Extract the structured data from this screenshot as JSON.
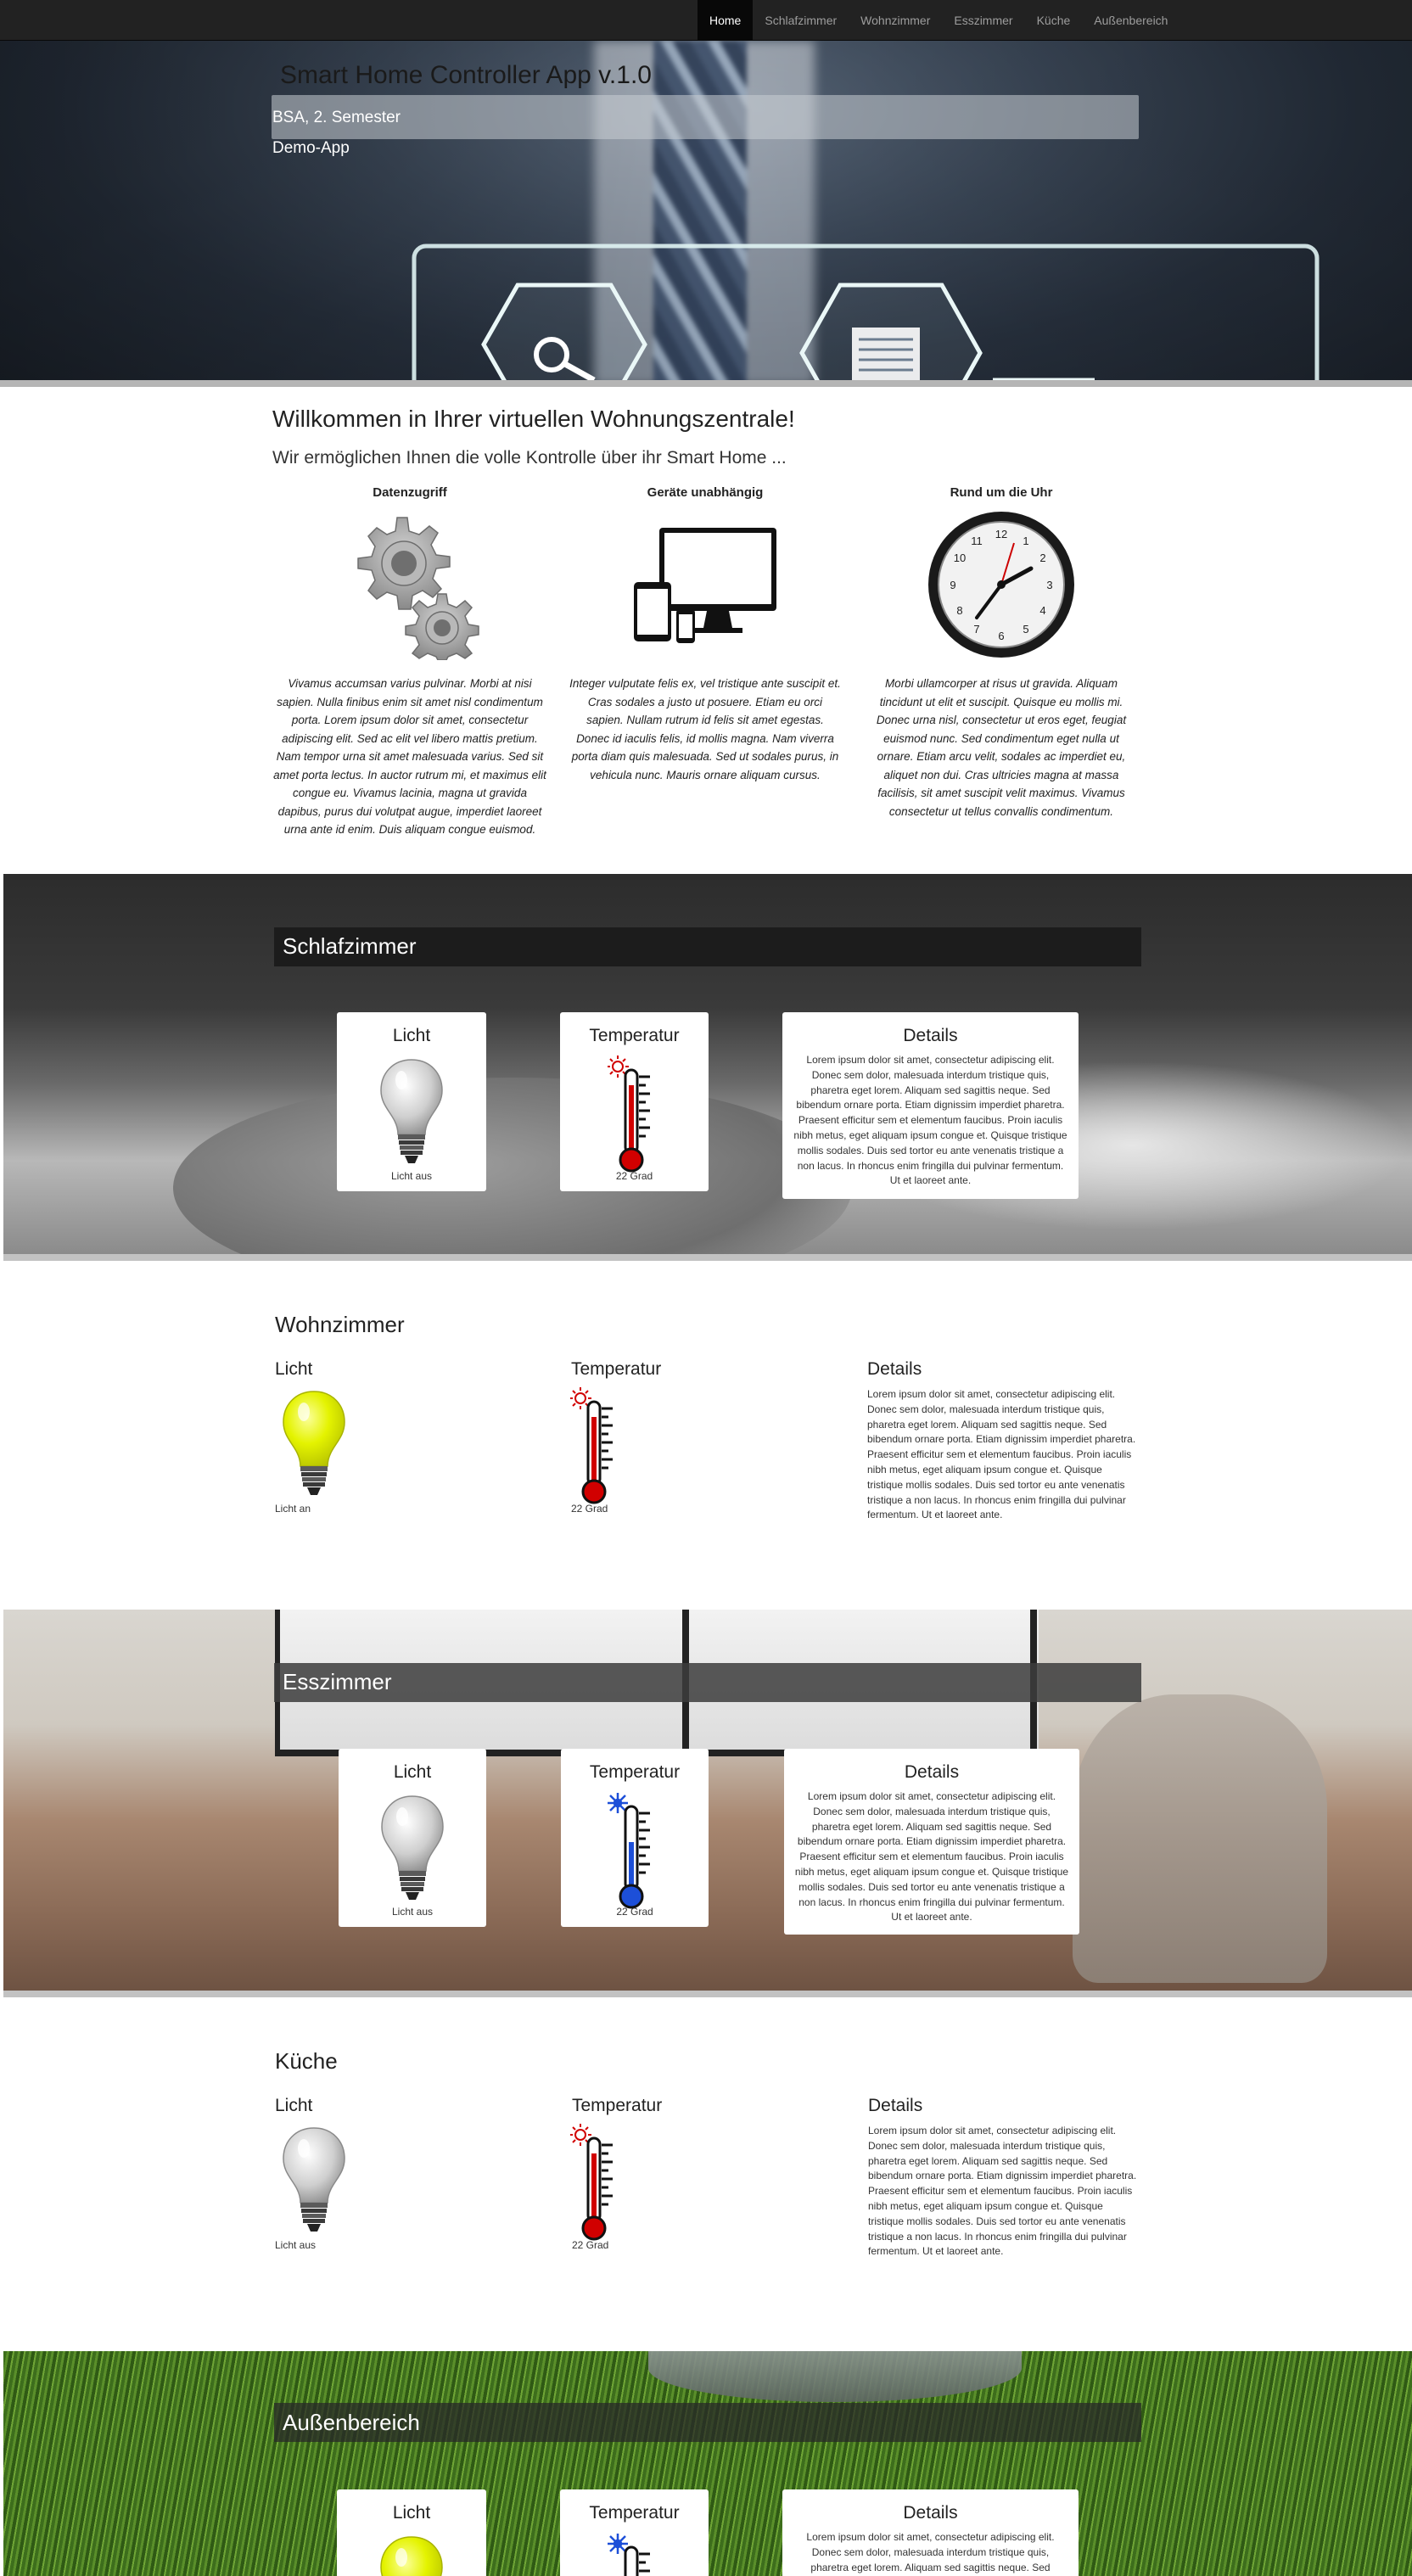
{
  "nav": {
    "items": [
      {
        "label": "Home",
        "active": true
      },
      {
        "label": "Schlafzimmer",
        "active": false
      },
      {
        "label": "Wohnzimmer",
        "active": false
      },
      {
        "label": "Esszimmer",
        "active": false
      },
      {
        "label": "Küche",
        "active": false
      },
      {
        "label": "Außenbereich",
        "active": false
      }
    ]
  },
  "hero": {
    "title": "Smart Home Controller App v.1.0",
    "subtitle1": "BSA, 2. Semester",
    "subtitle2": "Demo-App"
  },
  "welcome": {
    "heading": "Willkommen in Ihrer virtuellen Wohnungszentrale!",
    "subheading": "Wir ermöglichen Ihnen die volle Kontrolle über ihr Smart Home ...",
    "features": [
      {
        "title": "Datenzugriff",
        "icon": "gears-icon",
        "text": "Vivamus accumsan varius pulvinar. Morbi at nisi sapien. Nulla finibus enim sit amet nisl condimentum porta. Lorem ipsum dolor sit amet, consectetur adipiscing elit. Sed ac elit vel libero mattis pretium. Nam tempor urna sit amet malesuada varius. Sed sit amet porta lectus. In auctor rutrum mi, et maximus elit congue eu. Vivamus lacinia, magna ut gravida dapibus, purus dui volutpat augue, imperdiet laoreet urna ante id enim. Duis aliquam congue euismod."
      },
      {
        "title": "Geräte unabhängig",
        "icon": "devices-icon",
        "text": "Integer vulputate felis ex, vel tristique ante suscipit et. Cras sodales a justo ut posuere. Etiam eu orci sapien. Nullam rutrum id felis sit amet egestas. Donec id iaculis felis, id mollis magna. Nam viverra porta diam quis malesuada. Sed ut sodales purus, in vehicula nunc. Mauris ornare aliquam cursus."
      },
      {
        "title": "Rund um die Uhr",
        "icon": "clock-icon",
        "text": "Morbi ullamcorper at risus ut gravida. Aliquam tincidunt ut elit et suscipit. Quisque eu mollis mi. Donec urna nisl, consectetur ut eros eget, feugiat euismod nunc. Sed condimentum eget nulla ut ornare. Etiam arcu velit, sodales ac imperdiet eu, aliquet non dui. Cras ultricies magna at massa facilisis, sit amet suscipit velit maximus. Vivamus consectetur ut tellus convallis condimentum."
      }
    ]
  },
  "labels": {
    "licht": "Licht",
    "temperatur": "Temperatur",
    "details": "Details"
  },
  "details_text": "Lorem ipsum dolor sit amet, consectetur adipiscing elit. Donec sem dolor, malesuada interdum tristique quis, pharetra eget lorem. Aliquam sed sagittis neque. Sed bibendum ornare porta. Etiam dignissim imperdiet pharetra. Praesent efficitur sem et elementum faucibus. Proin iaculis nibh metus, eget aliquam ipsum congue et. Quisque tristique mollis sodales. Duis sed tortor eu ante venenatis tristique a non lacus. In rhoncus enim fringilla dui pulvinar fermentum. Ut et laoreet ante.",
  "rooms": [
    {
      "name": "Schlafzimmer",
      "light_status": "Licht aus",
      "light_on": false,
      "temperature": "22 Grad",
      "temp_mode": "warm"
    },
    {
      "name": "Wohnzimmer",
      "light_status": "Licht an",
      "light_on": true,
      "temperature": "22 Grad",
      "temp_mode": "warm"
    },
    {
      "name": "Esszimmer",
      "light_status": "Licht aus",
      "light_on": false,
      "temperature": "22 Grad",
      "temp_mode": "cold"
    },
    {
      "name": "Küche",
      "light_status": "Licht aus",
      "light_on": false,
      "temperature": "22 Grad",
      "temp_mode": "warm"
    },
    {
      "name": "Außenbereich",
      "light_status": "",
      "light_on": true,
      "temperature": "",
      "temp_mode": "cold"
    }
  ],
  "colors": {
    "navbar": "#222222",
    "bulb_on": "#e6f500",
    "bulb_off": "#d6d6d6",
    "thermo_warm": "#d10000",
    "thermo_cold": "#1d4fd8"
  }
}
